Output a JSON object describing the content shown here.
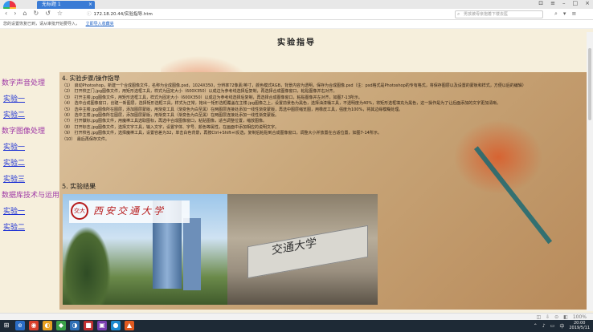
{
  "browser": {
    "tab_title": "无标题 1",
    "tab_close": "×",
    "window_controls": [
      "⊡",
      "≡",
      "–",
      "□",
      "×"
    ],
    "nav_icons": [
      "‹",
      "›",
      "⌂",
      "↻",
      "↺",
      "☆"
    ],
    "url": "172.18.20.44/实验指导.htm",
    "lock_icon": "ⓘ",
    "search_placeholder": "男孩被母亲抱着下楼去医",
    "search_icon": "⌕",
    "nav_right": [
      "⌕",
      "▾",
      "≡"
    ],
    "info_text": "您的设置恢复已到，请从审批开始要导入，",
    "info_link": "立即导入收藏夹"
  },
  "page": {
    "title": "实验指导",
    "sidebar": [
      {
        "label": "数字声音处理",
        "type": "category"
      },
      {
        "label": "实验一",
        "type": "link"
      },
      {
        "label": "实验二",
        "type": "link"
      },
      {
        "label": "数字图像处理",
        "type": "category"
      },
      {
        "label": "实验一",
        "type": "link"
      },
      {
        "label": "实验二",
        "type": "link"
      },
      {
        "label": "实验三",
        "type": "link"
      },
      {
        "label": "数据库技术与运用",
        "type": "category"
      },
      {
        "label": "实验一",
        "type": "link"
      },
      {
        "label": "实验二",
        "type": "link"
      }
    ],
    "section4_title": "4. 实验步骤/操作指导",
    "steps": [
      "（1）　启动Photoshop，新建一个合成图像文件，名称为合成图像.psd，1024X350，分辨率72像素/英寸，颜色模式RGB，背景内容为透明，保存为合成图像.psd（注：psd格式是Photoshop的专有格式，将保存图层以及设置的蒙板和样式，方便以后的编辑）",
      "（2）　打开校正门.jpg图像文件，用矩形选框工具，样式为固定大小（600X350）以成边为参考线选择后复制，再选择合成图像窗口，粘贴图像并右对齐。",
      "（3）　打开主楼.jpg图像文件，用矩形选框工具，样式为固定大小（600X350）以成边为参考线选择后复制，再选择合成图像窗口，粘贴图像并左对齐，如图7-13所示。",
      "（4）　选中合成图像窗口，创建一新图层，选择矩形选框工具，样式为正常，拖出一矩形选框覆盖在主楼.jpg图像之上，设置前景色为黑色，选择油漆桶工具，不透明度为40%，将矩形选框填充为黑色，这一操作是为了让后面添加的文字更加清晰。",
      "（5）　选中主楼.jpg图像所在图层，添加图层蒙版，用渐变工具（渐变色为白至黑）在两图层连接处添加一线性渐变蒙版，再选中图层缩览图，用橡皮工具，强度为100%，将其边缘模糊处理。",
      "（6）　选中主楼.jpg图像所在图层，添加图层蒙版，用渐变工具（渐变色为白至黑）在两图层连接处添加一线性渐变蒙版。",
      "（7）　打开徽标.jpg图像文件，用魔棒工具选取图标，再选中合成图像窗口，粘贴图像，适当调整位置，缩放图像。",
      "（8）　打开标志.jpg图像文件，选择文字工具，输入文字，设置字体、字号、颜色等属性，在画面中添加相应的说明文字。",
      "（9）　打开校名.jpg图像文件，选择魔棒工具，设置容差为32，单击白色背景，再按Ctrl+Shift+I反选，复制后粘贴到合成图像窗口，调整大小并放置在合适位置，如图7-14所示。",
      "（10）　最后再保存文件。"
    ],
    "section5_title": "5. 实验结果",
    "photo": {
      "seal_text": "交大",
      "banner_text": "西安交通大学",
      "gate_text": "交通大学"
    }
  },
  "taskbar": {
    "icons": [
      "⊞",
      "e",
      "◉",
      "◐",
      "◆",
      "◑",
      "■",
      "▣",
      "●",
      "▲"
    ],
    "clock_time": "20:00",
    "clock_date": "2019/5/11",
    "tray": [
      "⌃",
      "♪",
      "▭",
      "中"
    ]
  },
  "status_icons": [
    "◫",
    "⇩",
    "⊙",
    "◧",
    "100%"
  ]
}
